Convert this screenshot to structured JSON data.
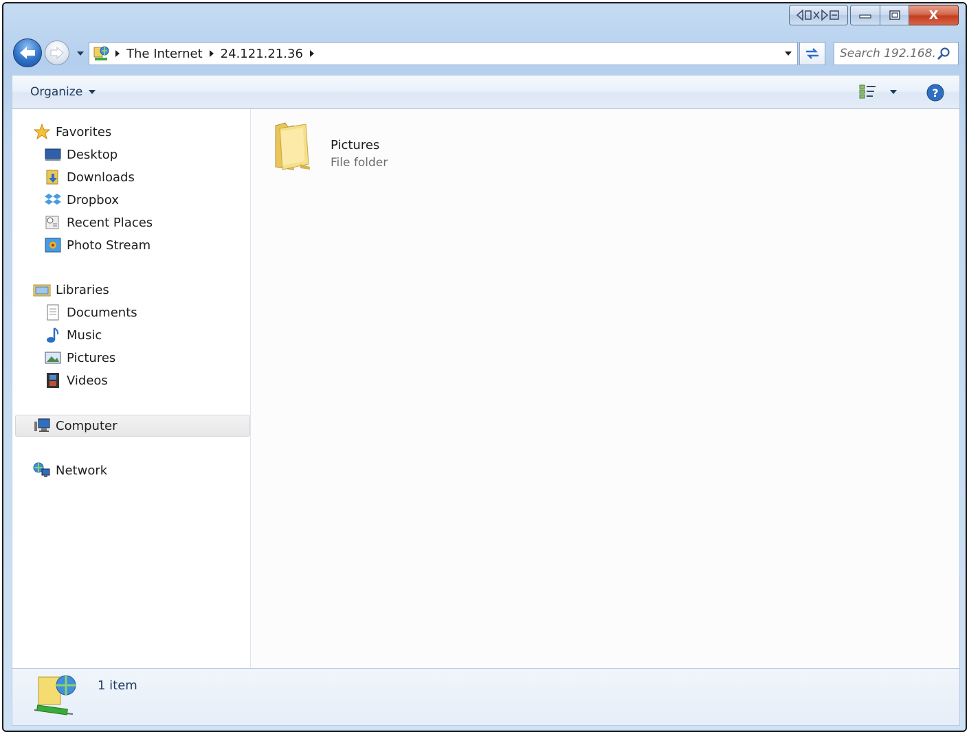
{
  "window": {
    "caption": {
      "minimize": "—",
      "maximize": "▫",
      "close": "X"
    }
  },
  "address": {
    "breadcrumbs": [
      "The Internet",
      "24.121.21.36"
    ]
  },
  "search": {
    "placeholder": "Search 192.168..."
  },
  "toolbar": {
    "organize_label": "Organize"
  },
  "navpane": {
    "favorites": {
      "label": "Favorites",
      "items": [
        {
          "label": "Desktop",
          "icon": "desktop-icon"
        },
        {
          "label": "Downloads",
          "icon": "downloads-icon"
        },
        {
          "label": "Dropbox",
          "icon": "dropbox-icon"
        },
        {
          "label": "Recent Places",
          "icon": "recent-places-icon"
        },
        {
          "label": "Photo Stream",
          "icon": "photo-stream-icon"
        }
      ]
    },
    "libraries": {
      "label": "Libraries",
      "items": [
        {
          "label": "Documents",
          "icon": "documents-icon"
        },
        {
          "label": "Music",
          "icon": "music-icon"
        },
        {
          "label": "Pictures",
          "icon": "pictures-icon"
        },
        {
          "label": "Videos",
          "icon": "videos-icon"
        }
      ]
    },
    "computer": {
      "label": "Computer",
      "selected": true
    },
    "network": {
      "label": "Network"
    }
  },
  "content": {
    "items": [
      {
        "name": "Pictures",
        "type": "File folder",
        "icon": "folder-icon"
      }
    ]
  },
  "status": {
    "item_count": "1 item"
  }
}
